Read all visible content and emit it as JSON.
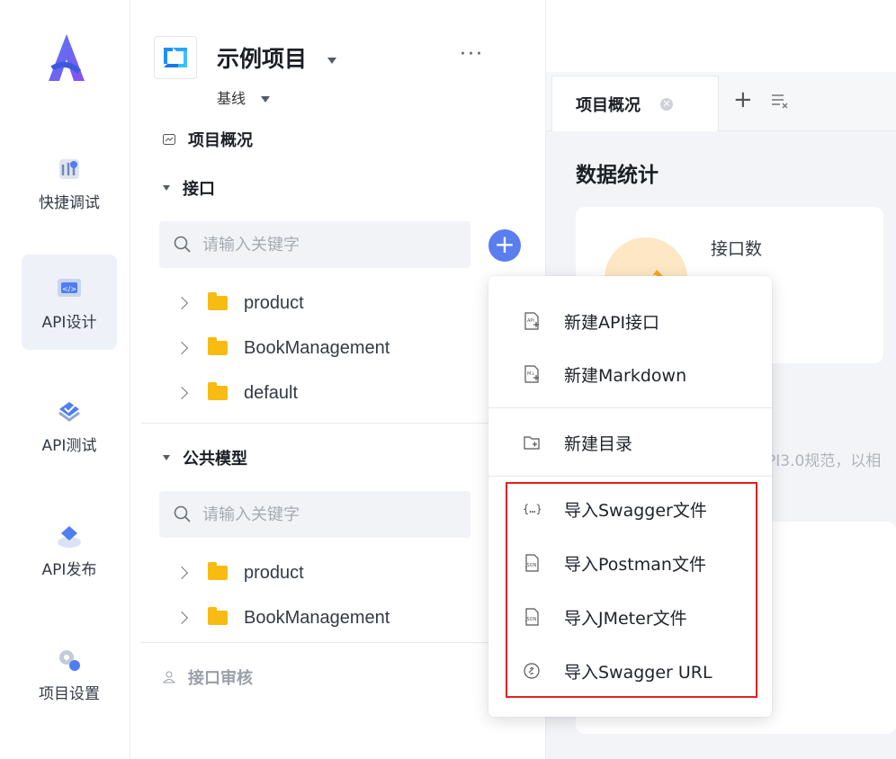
{
  "rail": {
    "items": [
      {
        "label": "快捷调试",
        "icon": "debug-icon"
      },
      {
        "label": "API设计",
        "icon": "api-design-icon",
        "active": true
      },
      {
        "label": "API测试",
        "icon": "api-test-icon"
      },
      {
        "label": "API发布",
        "icon": "api-publish-icon"
      },
      {
        "label": "项目设置",
        "icon": "settings-icon"
      }
    ]
  },
  "project": {
    "title": "示例项目",
    "baseline": "基线",
    "more": "···"
  },
  "tree": {
    "overview": "项目概况",
    "interfaces": {
      "title": "接口",
      "search_placeholder": "请输入关键字",
      "folders": [
        "product",
        "BookManagement",
        "default"
      ]
    },
    "models": {
      "title": "公共模型",
      "search_placeholder": "请输入关键字",
      "folders": [
        "product",
        "BookManagement"
      ]
    },
    "review": "接口审核"
  },
  "tabs": {
    "active": "项目概况",
    "add": "+",
    "menu_icon": "list-close-icon"
  },
  "content": {
    "section_title": "数据统计",
    "stat_label": "接口数",
    "desc_fragment": "PI3.0规范，以相"
  },
  "menu": {
    "items": [
      {
        "label": "新建API接口",
        "icon": "new-api-icon"
      },
      {
        "label": "新建Markdown",
        "icon": "new-markdown-icon"
      },
      {
        "label": "新建目录",
        "icon": "new-folder-icon"
      },
      {
        "label": "导入Swagger文件",
        "icon": "swagger-file-icon"
      },
      {
        "label": "导入Postman文件",
        "icon": "postman-file-icon"
      },
      {
        "label": "导入JMeter文件",
        "icon": "jmeter-file-icon"
      },
      {
        "label": "导入Swagger URL",
        "icon": "link-icon"
      }
    ]
  },
  "colors": {
    "accent": "#5a7ef0",
    "highlight_border": "#e0211f",
    "folder": "#f7bb12"
  }
}
